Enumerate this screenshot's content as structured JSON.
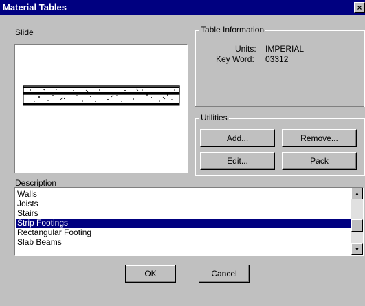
{
  "window": {
    "title": "Material Tables",
    "close_glyph": "×"
  },
  "slide": {
    "label": "Slide"
  },
  "table_info": {
    "label": "Table Information",
    "units_label": "Units:",
    "units_value": "IMPERIAL",
    "keyword_label": "Key Word:",
    "keyword_value": "03312"
  },
  "utilities": {
    "label": "Utilities",
    "add": "Add...",
    "remove": "Remove...",
    "edit": "Edit...",
    "pack": "Pack"
  },
  "description": {
    "label": "Description",
    "items": [
      "Walls",
      "Joists",
      "Stairs",
      "Strip Footings",
      "Rectangular Footing",
      "Slab Beams"
    ],
    "selected": "Strip Footings"
  },
  "footer": {
    "ok": "OK",
    "cancel": "Cancel"
  }
}
